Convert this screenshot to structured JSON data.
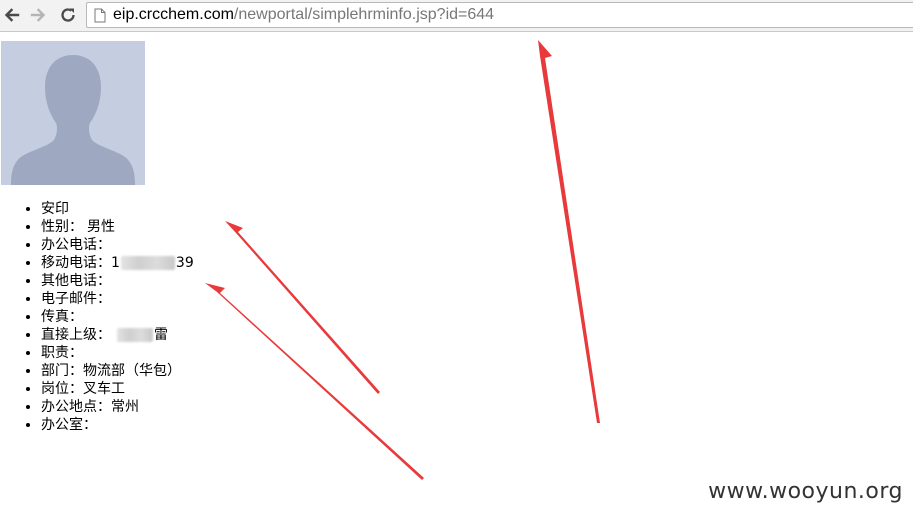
{
  "browser": {
    "url_host": "eip.crcchem.com",
    "url_path": "/newportal/simplehrminfo.jsp?id=644"
  },
  "profile": {
    "items": [
      {
        "label": "安印",
        "value": ""
      },
      {
        "label": "性别：",
        "value": "男性"
      },
      {
        "label": "办公电话：",
        "value": ""
      },
      {
        "label": "移动电话：",
        "value_prefix": "1",
        "value_suffix": "39"
      },
      {
        "label": "其他电话：",
        "value": ""
      },
      {
        "label": "电子邮件：",
        "value": ""
      },
      {
        "label": "传真：",
        "value": ""
      },
      {
        "label": "直接上级：",
        "value_suffix": "雷"
      },
      {
        "label": "职责：",
        "value": ""
      },
      {
        "label": "部门：",
        "value": "物流部（华包）"
      },
      {
        "label": "岗位：",
        "value": "叉车工"
      },
      {
        "label": "办公地点：",
        "value": "常州"
      },
      {
        "label": "办公室：",
        "value": ""
      }
    ]
  },
  "annotation_color": "#e8393b",
  "watermark": "www.wooyun.org"
}
